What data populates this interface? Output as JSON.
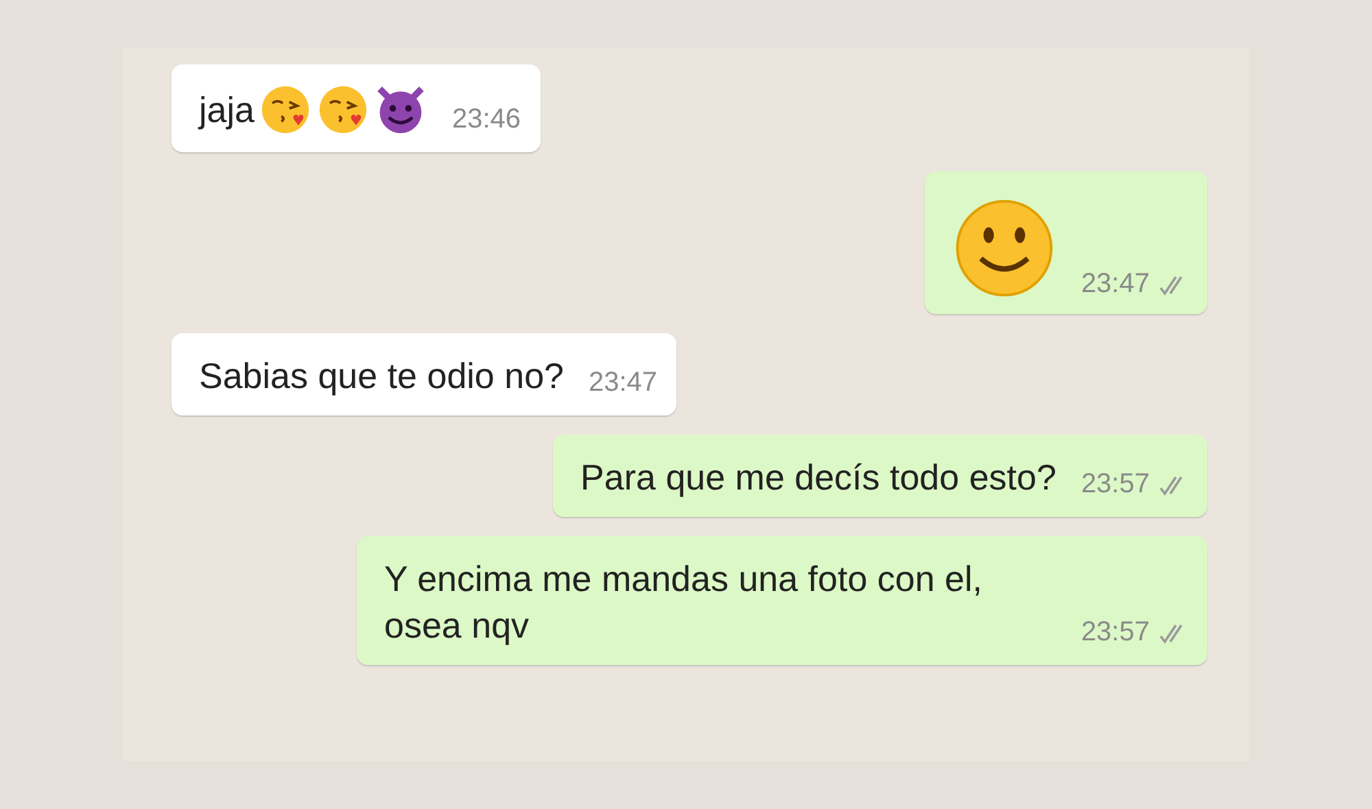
{
  "messages": [
    {
      "sent": false,
      "text": "jaja",
      "emojis": [
        {
          "kind": "kiss"
        },
        {
          "kind": "kiss"
        },
        {
          "kind": "devil"
        }
      ],
      "time": "23:46"
    },
    {
      "sent": true,
      "emojis": [
        {
          "kind": "smile"
        }
      ],
      "time": "23:47",
      "read": false
    },
    {
      "sent": false,
      "text": "Sabias que te odio no?",
      "time": "23:47"
    },
    {
      "sent": true,
      "text": "Para que me decís todo esto?",
      "time": "23:57",
      "read": false
    },
    {
      "sent": true,
      "text": "Y encima me mandas una foto con el, osea nqv",
      "time": "23:57",
      "read": false
    }
  ]
}
